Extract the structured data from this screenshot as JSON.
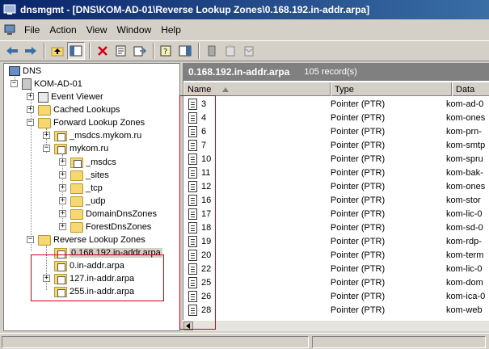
{
  "window": {
    "title": "dnsmgmt - [DNS\\KOM-AD-01\\Reverse Lookup Zones\\0.168.192.in-addr.arpa]"
  },
  "menu": [
    "File",
    "Action",
    "View",
    "Window",
    "Help"
  ],
  "toolbar": {
    "icons": [
      "back-icon",
      "forward-icon",
      "up-folder-icon",
      "show-tree-icon",
      "delete-icon",
      "properties-icon",
      "export-icon",
      "help-icon",
      "show-console-icon",
      "server-icon",
      "new-host-icon",
      "new-mail-icon"
    ]
  },
  "tree": {
    "root": "DNS",
    "server": "KOM-AD-01",
    "event_viewer": "Event Viewer",
    "cached_lookups": "Cached Lookups",
    "forward_zones": "Forward Lookup Zones",
    "msdcs_zone": "_msdcs.mykom.ru",
    "mykom": "mykom.ru",
    "sub_msdcs": "_msdcs",
    "sub_sites": "_sites",
    "sub_tcp": "_tcp",
    "sub_udp": "_udp",
    "domain_dns": "DomainDnsZones",
    "forest_dns": "ForestDnsZones",
    "reverse_zones": "Reverse Lookup Zones",
    "rz0": "0.168.192.in-addr.arpa",
    "rz1": "0.in-addr.arpa",
    "rz2": "127.in-addr.arpa",
    "rz3": "255.in-addr.arpa"
  },
  "right": {
    "zone_name": "0.168.192.in-addr.arpa",
    "record_count": "105 record(s)",
    "columns": {
      "name": "Name",
      "type": "Type",
      "data": "Data"
    },
    "records": [
      {
        "name": "3",
        "type": "Pointer (PTR)",
        "data": "kom-ad-0"
      },
      {
        "name": "4",
        "type": "Pointer (PTR)",
        "data": "kom-ones"
      },
      {
        "name": "6",
        "type": "Pointer (PTR)",
        "data": "kom-prn-"
      },
      {
        "name": "7",
        "type": "Pointer (PTR)",
        "data": "kom-smtp"
      },
      {
        "name": "10",
        "type": "Pointer (PTR)",
        "data": "kom-spru"
      },
      {
        "name": "11",
        "type": "Pointer (PTR)",
        "data": "kom-bak-"
      },
      {
        "name": "12",
        "type": "Pointer (PTR)",
        "data": "kom-ones"
      },
      {
        "name": "16",
        "type": "Pointer (PTR)",
        "data": "kom-stor"
      },
      {
        "name": "17",
        "type": "Pointer (PTR)",
        "data": "kom-lic-0"
      },
      {
        "name": "18",
        "type": "Pointer (PTR)",
        "data": "kom-sd-0"
      },
      {
        "name": "19",
        "type": "Pointer (PTR)",
        "data": "kom-rdp-"
      },
      {
        "name": "20",
        "type": "Pointer (PTR)",
        "data": "kom-term"
      },
      {
        "name": "22",
        "type": "Pointer (PTR)",
        "data": "kom-lic-0"
      },
      {
        "name": "25",
        "type": "Pointer (PTR)",
        "data": "kom-dom"
      },
      {
        "name": "26",
        "type": "Pointer (PTR)",
        "data": "kom-ica-0"
      },
      {
        "name": "28",
        "type": "Pointer (PTR)",
        "data": "kom-web"
      }
    ]
  },
  "colors": {
    "titlebar": "#0a246a",
    "highlight_box": "#d00018",
    "panel_header": "#808080"
  }
}
